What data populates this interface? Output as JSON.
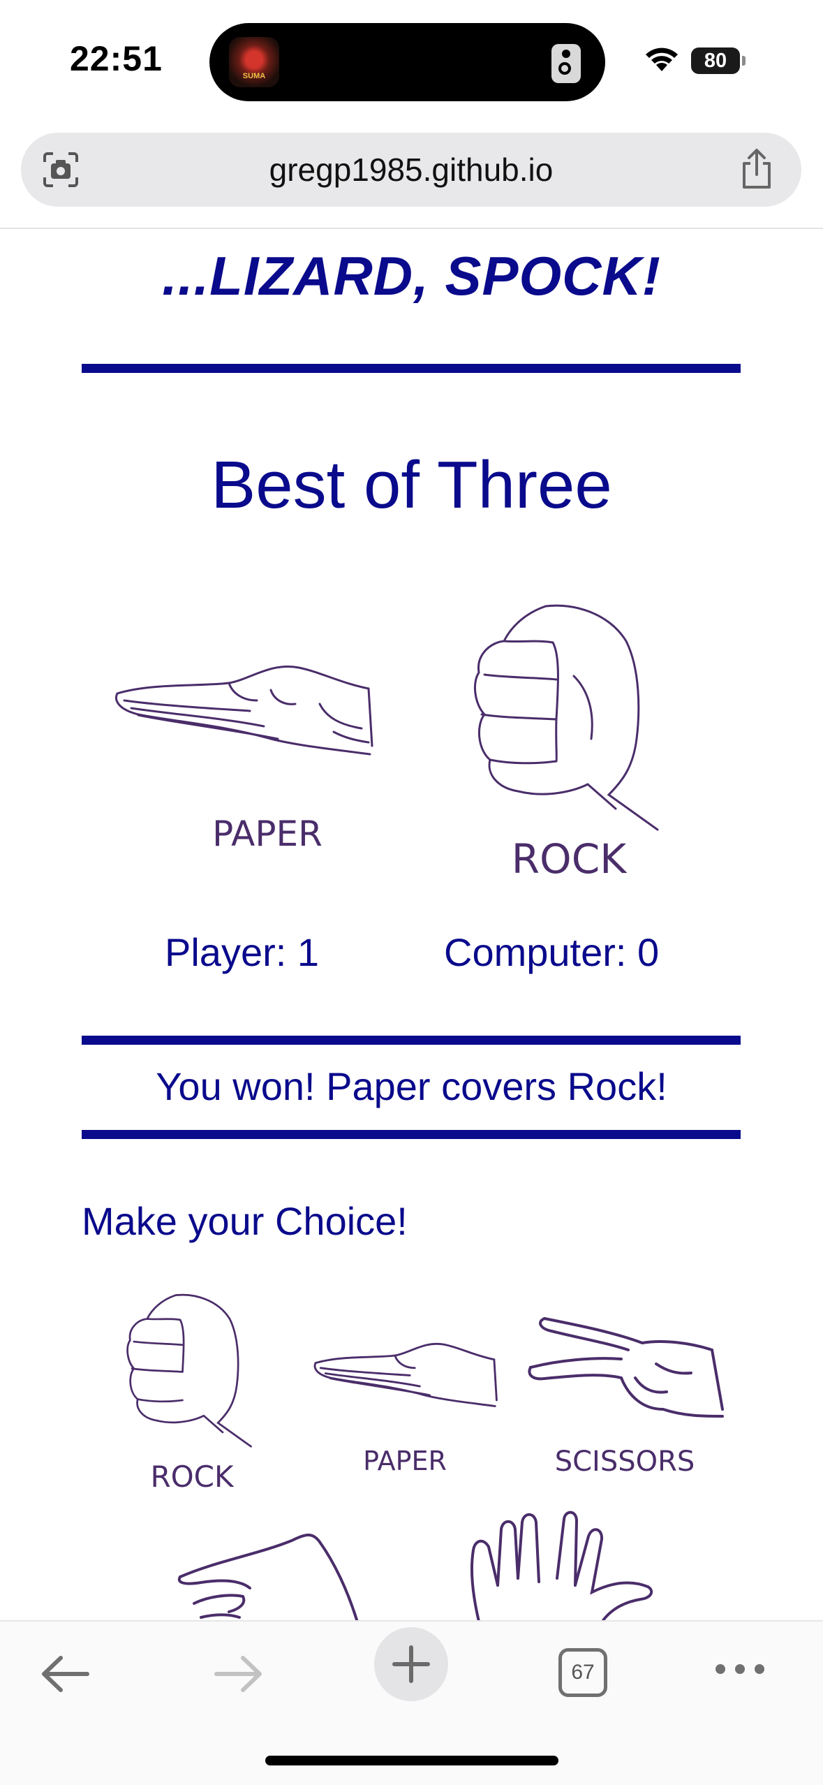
{
  "status_bar": {
    "time": "22:51",
    "battery": "80",
    "icons": [
      "wifi-icon",
      "battery-icon",
      "speaker-icon"
    ]
  },
  "browser": {
    "url": "gregp1985.github.io",
    "tab_count": "67"
  },
  "page": {
    "heading": "...LIZARD, SPOCK!",
    "game_mode": "Best of Three",
    "player_choice": {
      "label": "PAPER",
      "icon": "paper-hand-icon"
    },
    "computer_choice": {
      "label": "ROCK",
      "icon": "rock-hand-icon"
    },
    "score": {
      "player": "Player: 1",
      "computer": "Computer: 0"
    },
    "result": "You won! Paper covers Rock!",
    "choice_title": "Make your Choice!",
    "choices": [
      {
        "label": "ROCK",
        "icon": "rock-hand-icon"
      },
      {
        "label": "PAPER",
        "icon": "paper-hand-icon"
      },
      {
        "label": "SCISSORS",
        "icon": "scissors-hand-icon"
      },
      {
        "label": "",
        "icon": "lizard-hand-icon"
      },
      {
        "label": "",
        "icon": "spock-hand-icon"
      }
    ]
  },
  "colors": {
    "accent": "#0a0a8c",
    "hand_ink": "#4a2d6a"
  }
}
